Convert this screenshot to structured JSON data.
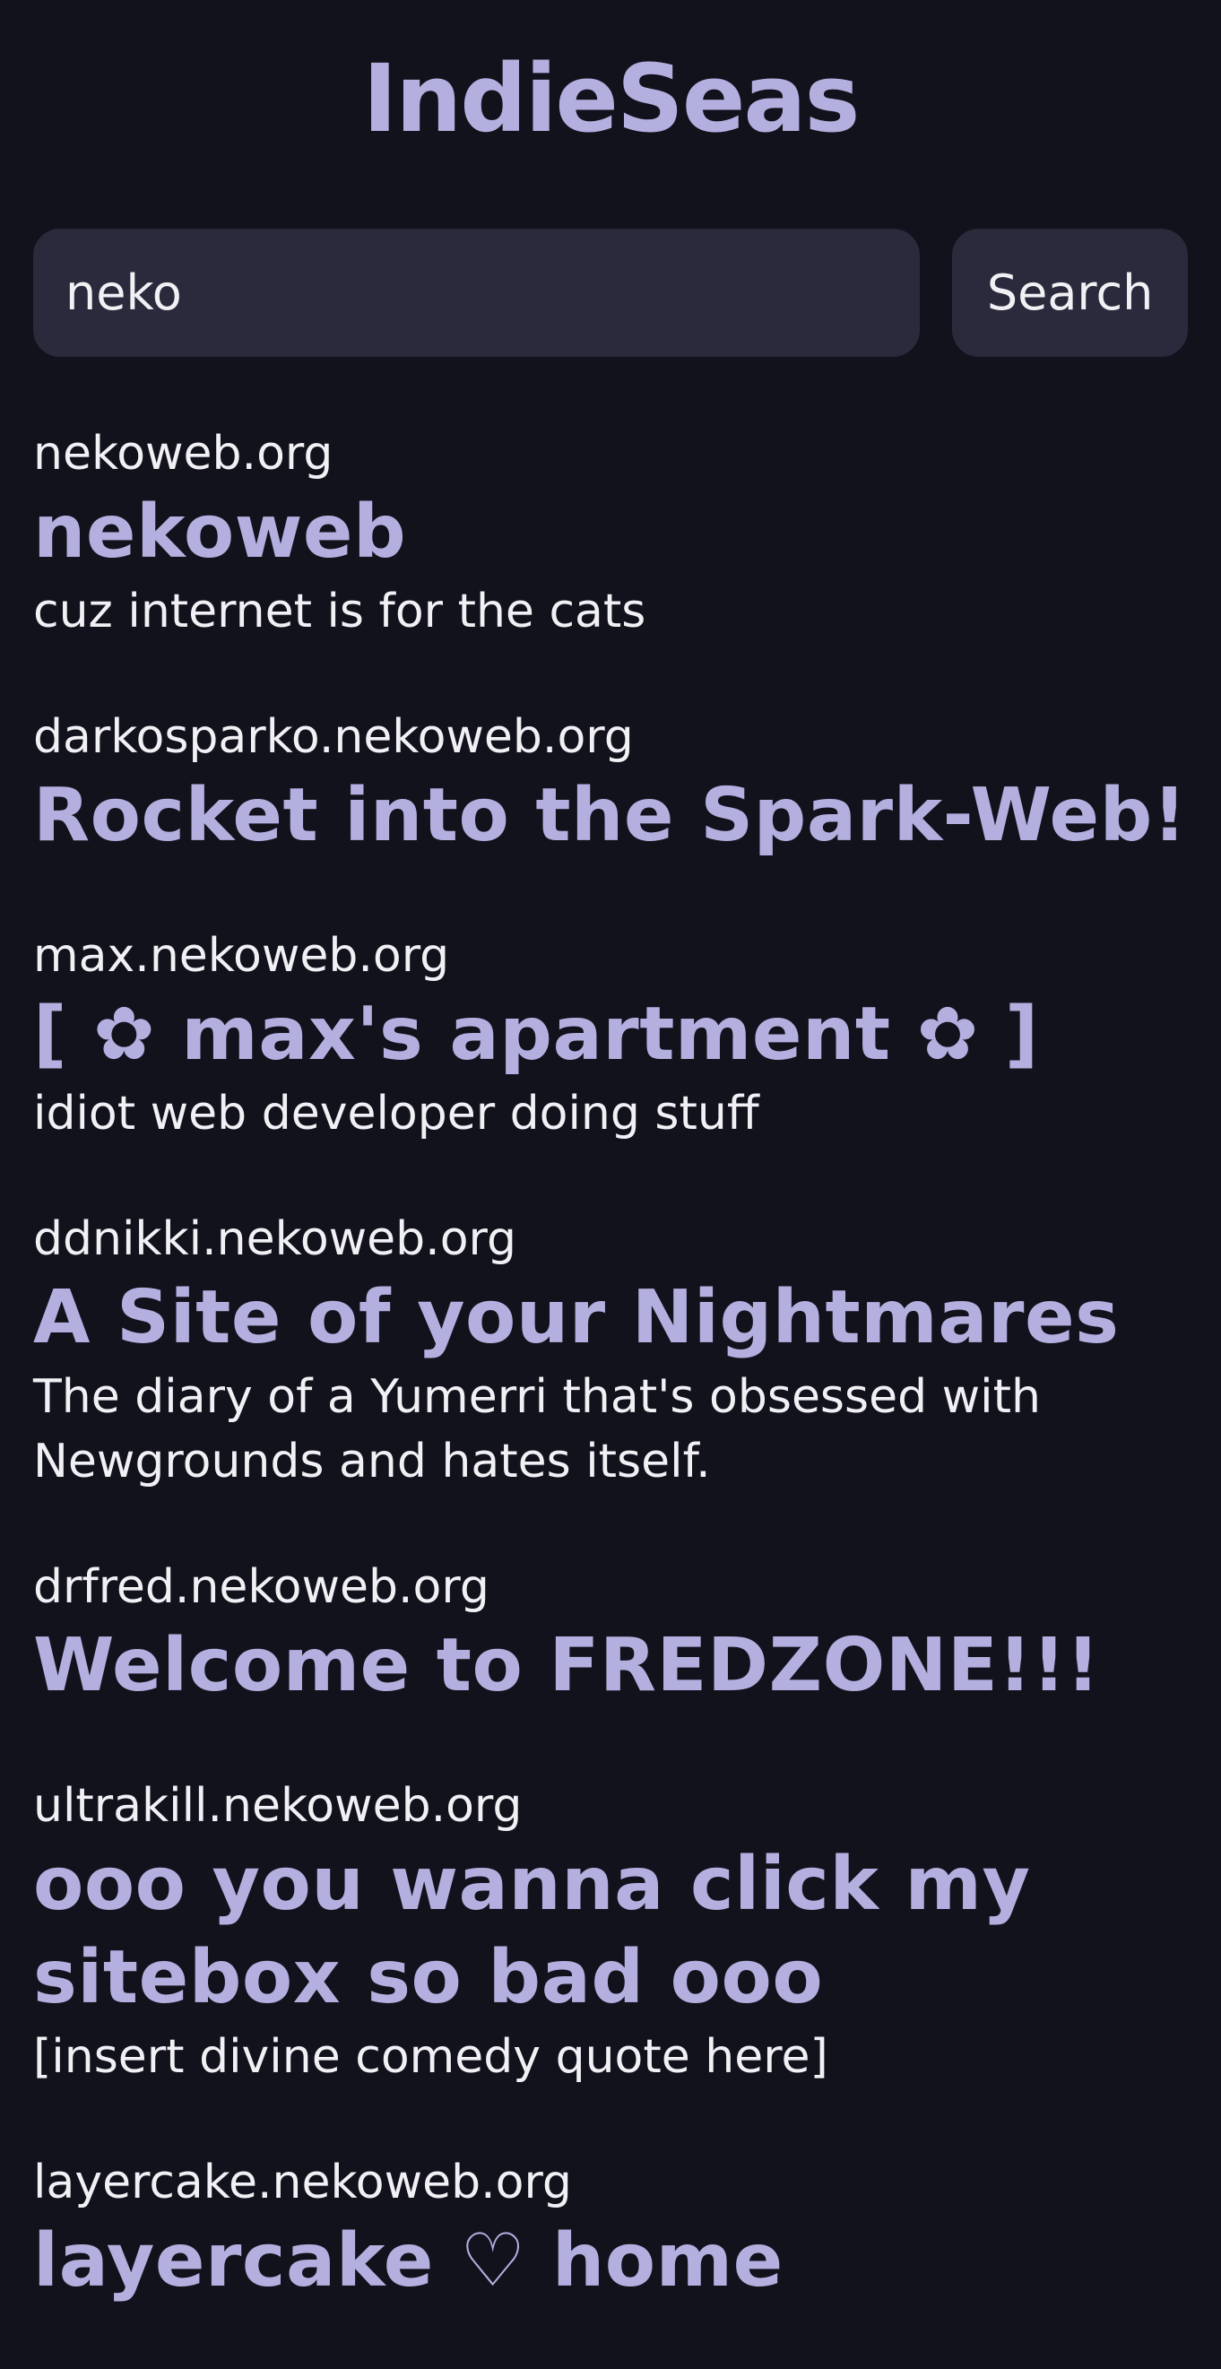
{
  "header": {
    "logo_text": "IndieSeas"
  },
  "search": {
    "query": "neko",
    "button_label": "Search"
  },
  "results": [
    {
      "url": "nekoweb.org",
      "title": "nekoweb",
      "description": "cuz internet is for the cats"
    },
    {
      "url": "darkosparko.nekoweb.org",
      "title": "Rocket into the Spark-Web!",
      "description": ""
    },
    {
      "url": "max.nekoweb.org",
      "title": "[ ✿ max's apartment ✿ ]",
      "description": "idiot web developer doing stuff"
    },
    {
      "url": "ddnikki.nekoweb.org",
      "title": "A Site of your Nightmares",
      "description": "The diary of a Yumerri that's obsessed with Newgrounds and hates itself."
    },
    {
      "url": "drfred.nekoweb.org",
      "title": "Welcome to FREDZONE!!!",
      "description": ""
    },
    {
      "url": "ultrakill.nekoweb.org",
      "title": "ooo you wanna click my sitebox so bad ooo",
      "description": "[insert divine comedy quote here]"
    },
    {
      "url": "layercake.nekoweb.org",
      "title": "layercake ♡ home",
      "description": ""
    }
  ],
  "colors": {
    "background": "#12121d",
    "accent": "#b3b0e0",
    "input_bg": "#2a2a3c",
    "text": "#f1f1f5"
  }
}
